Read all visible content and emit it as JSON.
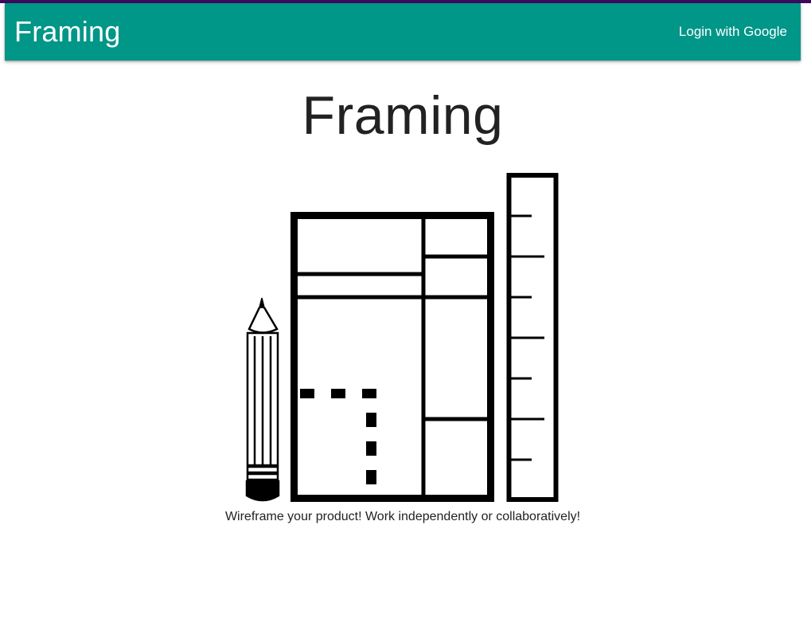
{
  "app_bar": {
    "brand": "Framing",
    "login_label": "Login with Google",
    "color": "#009688"
  },
  "hero": {
    "title": "Framing",
    "tagline": "Wireframe your product! Work independently or collaboratively!"
  },
  "illustration": {
    "items": [
      "pencil-icon",
      "wireframe-icon",
      "ruler-icon"
    ]
  },
  "colors": {
    "accent_strip": "#3b0a5e",
    "text": "#222222",
    "background": "#ffffff"
  }
}
